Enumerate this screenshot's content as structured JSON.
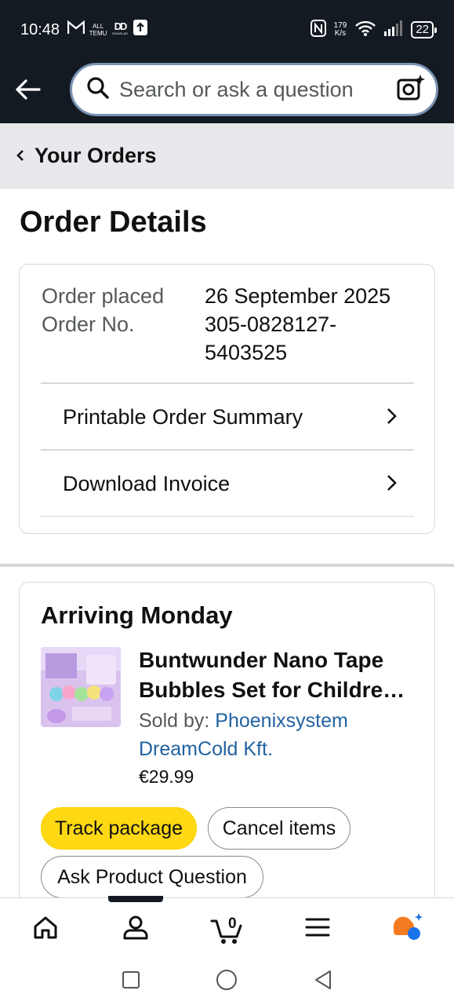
{
  "status_bar": {
    "time": "10:48",
    "icon_temu_top": "ALL",
    "icon_temu_bottom": "TEMU",
    "icon_douglas": "DOUGLAS",
    "speed_value": "179",
    "speed_unit": "K/s",
    "battery": "22"
  },
  "header": {
    "search_placeholder": "Search or ask a question"
  },
  "breadcrumb": {
    "label": "Your Orders"
  },
  "page": {
    "title": "Order Details"
  },
  "order_info": {
    "placed_label": "Order placed",
    "placed_value": "26 September 2025",
    "number_label": "Order No.",
    "number_value_line1": "305-0828127-",
    "number_value_line2": "5403525",
    "links": [
      {
        "label": "Printable Order Summary"
      },
      {
        "label": "Download Invoice"
      }
    ]
  },
  "shipment": {
    "status": "Arriving Monday",
    "product_title_line1": "Buntwunder Nano Tape",
    "product_title_line2": "Bubbles Set for Childre…",
    "sold_by_label": "Sold by:",
    "seller_line1": "Phoenixsystem",
    "seller_line2": "DreamCold Kft.",
    "price": "€29.99",
    "buttons": {
      "track": "Track package",
      "cancel": "Cancel items",
      "ask": "Ask Product Question"
    }
  },
  "bottom_nav": {
    "cart_count": "0",
    "active_tab": "account",
    "icons": [
      "home-icon",
      "account-icon",
      "cart-icon",
      "menu-icon",
      "rufus-icon"
    ]
  },
  "colors": {
    "header_bg": "#131a22",
    "track_button": "#ffd814",
    "link": "#2162a1",
    "breadcrumb_bg": "#e7e9ec"
  }
}
